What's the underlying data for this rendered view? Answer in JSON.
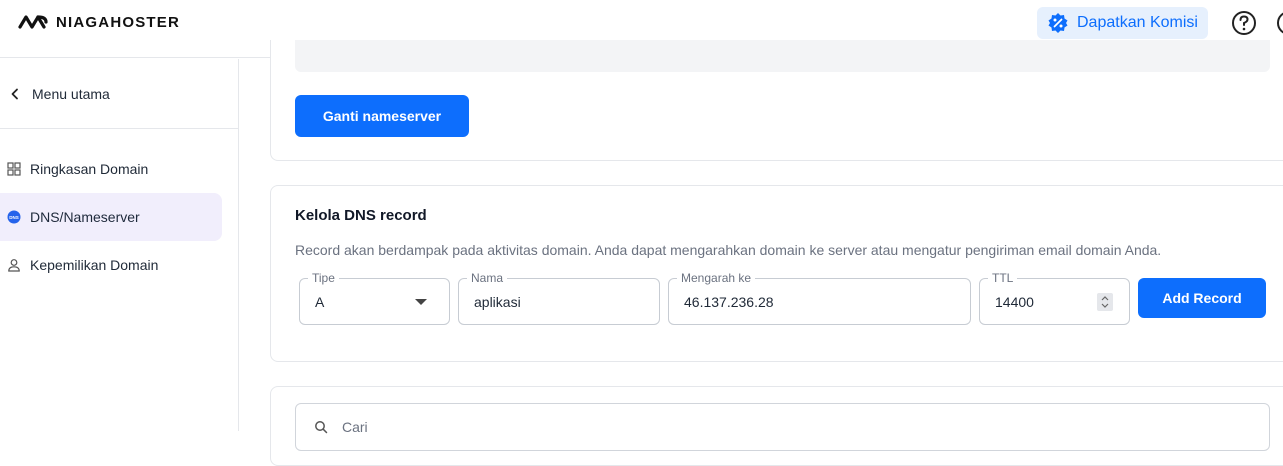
{
  "header": {
    "logo_text": "NIAGAHOSTER",
    "komisi_label": "Dapatkan Komisi",
    "help_icon": "question-circle-icon"
  },
  "sidebar": {
    "back_label": "Menu utama",
    "items": [
      {
        "label": "Ringkasan Domain",
        "icon": "grid-icon",
        "active": false
      },
      {
        "label": "DNS/Nameserver",
        "icon": "dns-icon",
        "active": true
      },
      {
        "label": "Kepemilikan Domain",
        "icon": "user-icon",
        "active": false
      }
    ]
  },
  "nameserver": {
    "button_label": "Ganti nameserver"
  },
  "dns": {
    "title": "Kelola DNS record",
    "description": "Record akan berdampak pada aktivitas domain. Anda dapat mengarahkan domain ke server atau mengatur pengiriman email domain Anda.",
    "fields": {
      "tipe": {
        "label": "Tipe",
        "value": "A"
      },
      "nama": {
        "label": "Nama",
        "value": "aplikasi"
      },
      "arah": {
        "label": "Mengarah ke",
        "value": "46.137.236.28"
      },
      "ttl": {
        "label": "TTL",
        "value": "14400"
      }
    },
    "add_button": "Add Record"
  },
  "search": {
    "placeholder": "Cari"
  },
  "colors": {
    "primary": "#0d6efd",
    "active_bg": "#f1eefc",
    "komisi_bg": "#e6f0fd"
  }
}
